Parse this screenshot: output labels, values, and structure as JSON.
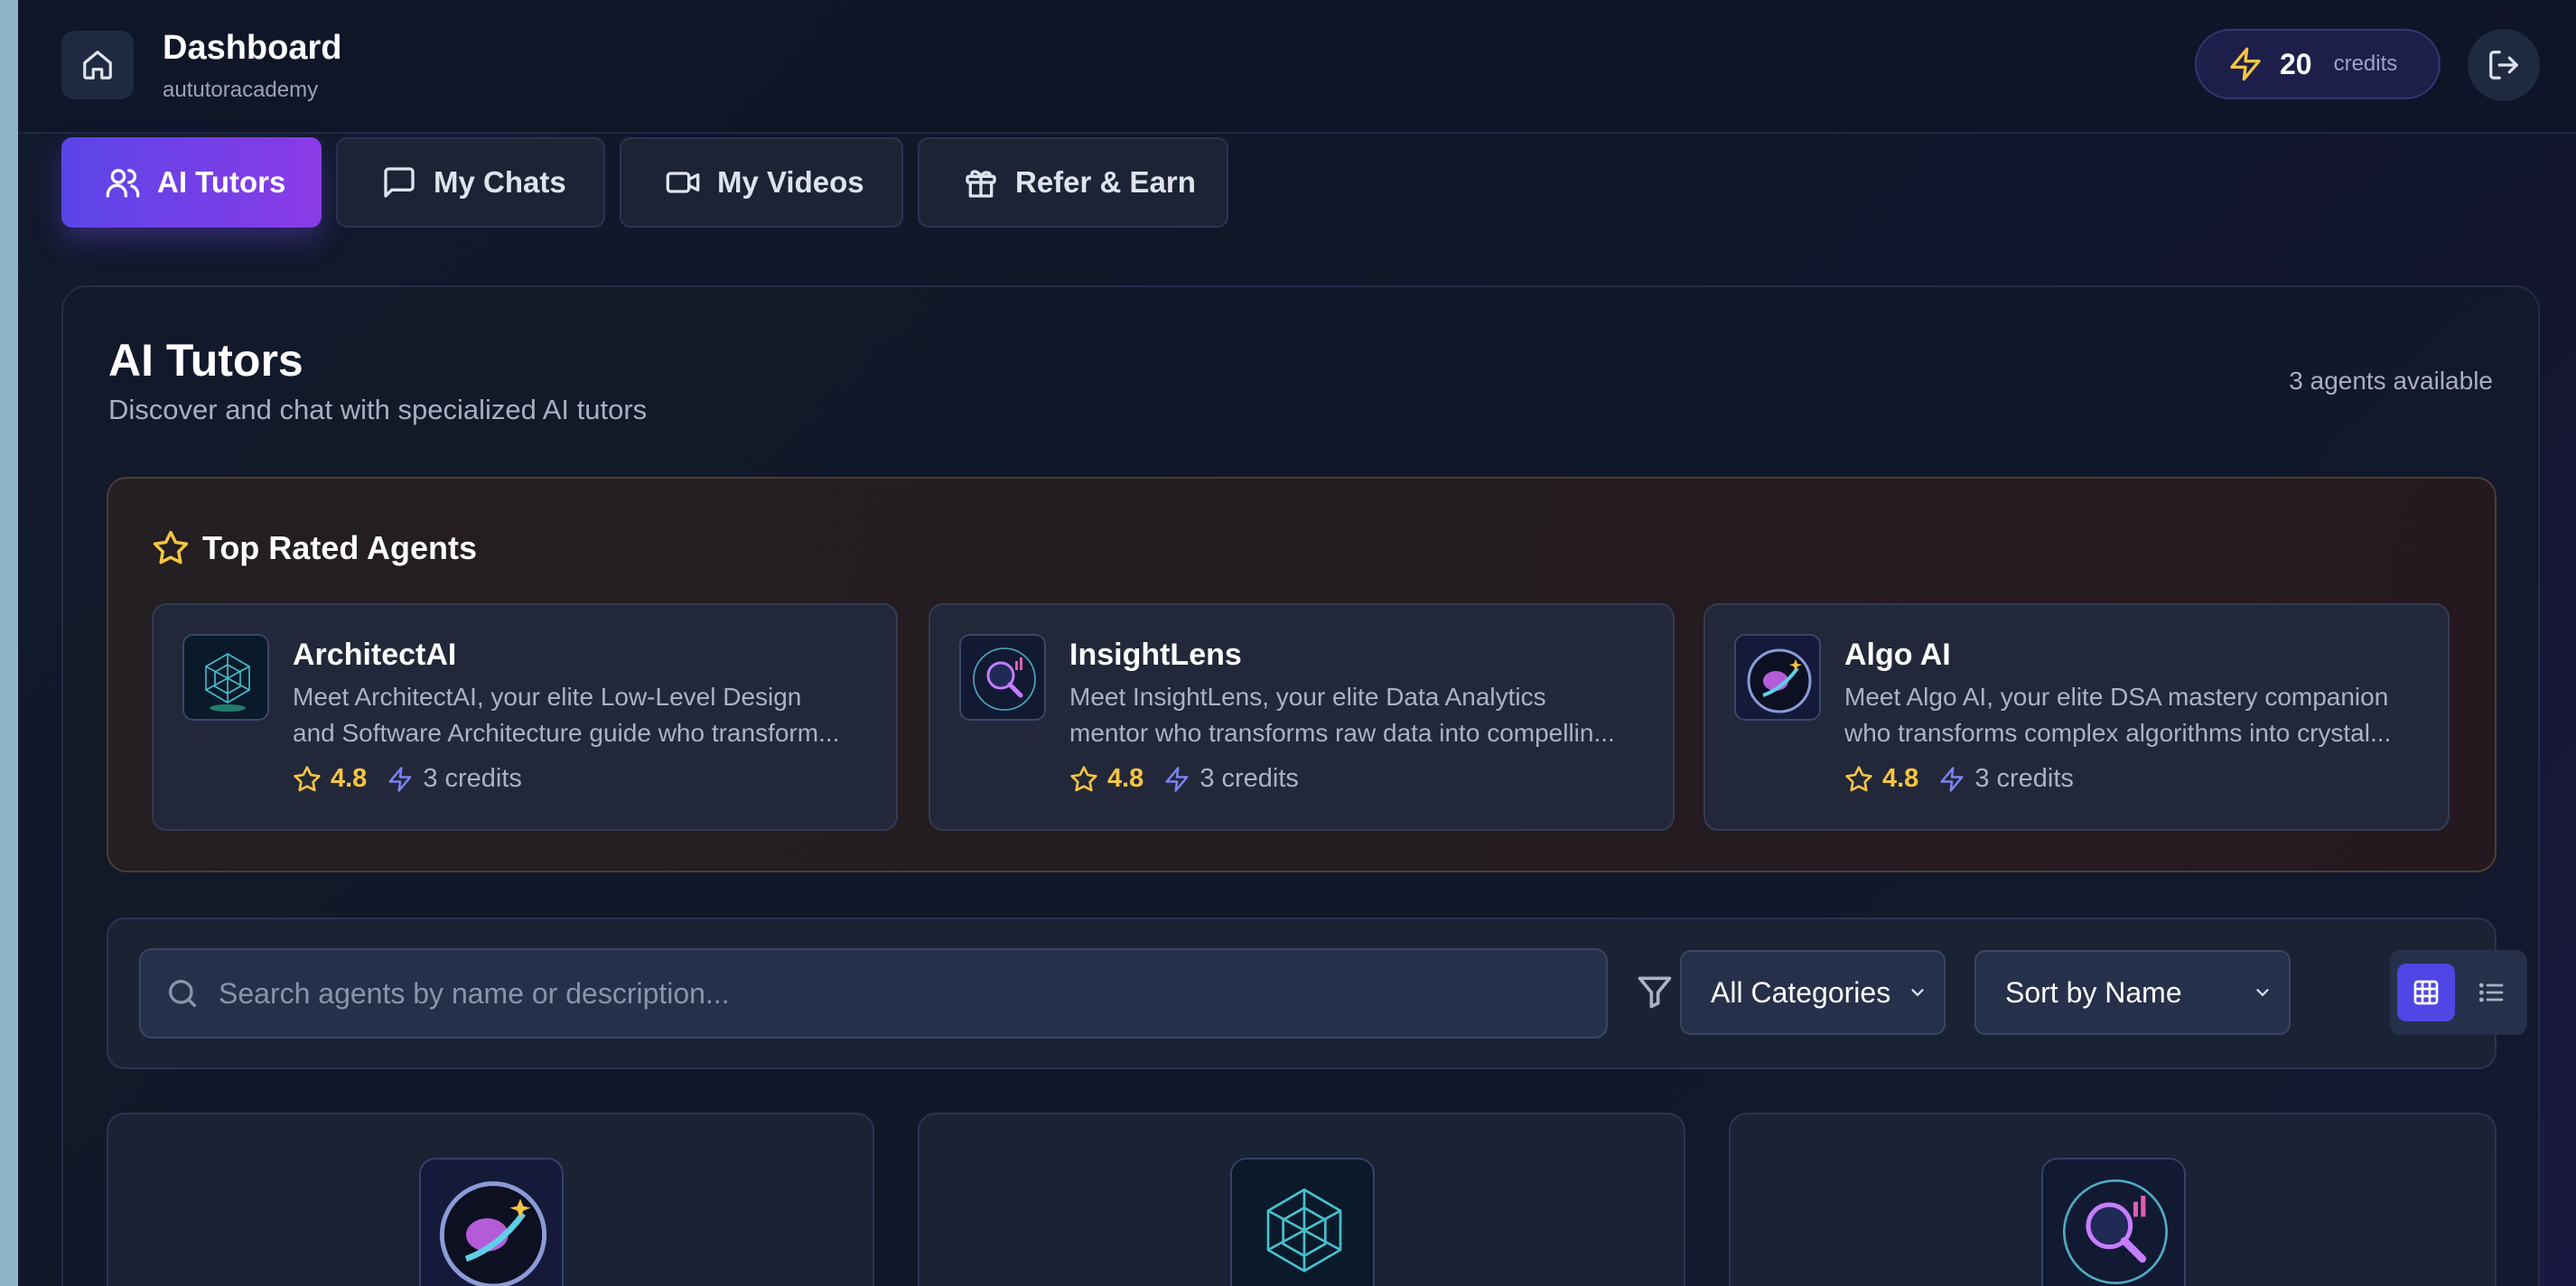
{
  "header": {
    "title": "Dashboard",
    "subtitle": "aututoracademy",
    "credits_value": "20",
    "credits_label": "credits"
  },
  "tabs": [
    {
      "label": "AI Tutors",
      "icon": "users-icon",
      "active": true
    },
    {
      "label": "My Chats",
      "icon": "message-square-icon",
      "active": false
    },
    {
      "label": "My Videos",
      "icon": "video-icon",
      "active": false
    },
    {
      "label": "Refer & Earn",
      "icon": "gift-icon",
      "active": false
    }
  ],
  "main": {
    "title": "AI Tutors",
    "subtitle": "Discover and chat with specialized AI tutors",
    "agents_count": "3 agents available"
  },
  "top_rated": {
    "title": "Top Rated Agents",
    "agents": [
      {
        "name": "ArchitectAI",
        "desc_line1": "Meet ArchitectAI, your elite Low-Level Design",
        "desc_line2": "and Software Architecture guide who transform...",
        "rating": "4.8",
        "credits": "3 credits"
      },
      {
        "name": "InsightLens",
        "desc_line1": "Meet InsightLens, your elite Data Analytics",
        "desc_line2": "mentor who transforms raw data into compellin...",
        "rating": "4.8",
        "credits": "3 credits"
      },
      {
        "name": "Algo AI",
        "desc_line1": "Meet Algo AI, your elite DSA mastery companion",
        "desc_line2": "who transforms complex algorithms into crystal...",
        "rating": "4.8",
        "credits": "3 credits"
      }
    ]
  },
  "filters": {
    "search_placeholder": "Search agents by name or description...",
    "category_selected": "All Categories",
    "sort_selected": "Sort by Name",
    "view_mode": "grid"
  },
  "colors": {
    "accent": "#5b45e8",
    "accent_end": "#8a3be6",
    "star": "#f5c542",
    "bolt": "#7c83f0"
  }
}
